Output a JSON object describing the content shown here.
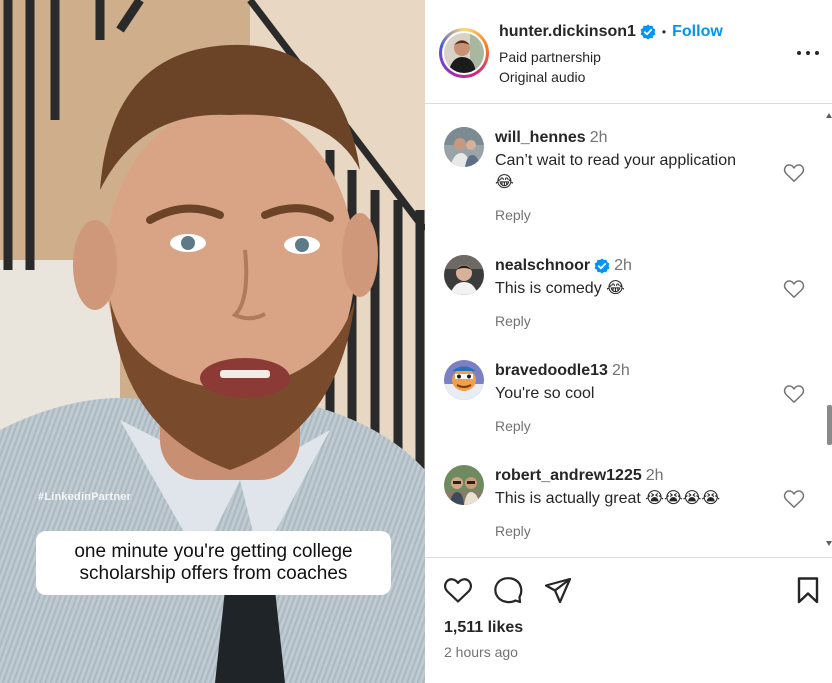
{
  "video": {
    "watermark": "#LinkedinPartner",
    "caption": "one minute you're getting college scholarship offers from coaches"
  },
  "post": {
    "username": "hunter.dickinson1",
    "verified": true,
    "separator": "•",
    "follow_label": "Follow",
    "subtitle_1": "Paid partnership",
    "subtitle_2": "Original audio",
    "more_icon": "more-horizontal-icon"
  },
  "comments": [
    {
      "user": "will_hennes",
      "verified": false,
      "time": "2h",
      "text": "Can’t wait to read your application",
      "emoji": "😂",
      "reply_label": "Reply"
    },
    {
      "user": "nealschnoor",
      "verified": true,
      "time": "2h",
      "text": "This is comedy 😂",
      "reply_label": "Reply"
    },
    {
      "user": "bravedoodle13",
      "verified": false,
      "time": "2h",
      "text": "You're so cool",
      "reply_label": "Reply"
    },
    {
      "user": "robert_andrew1225",
      "verified": false,
      "time": "2h",
      "text": "This is actually great 😭😭😭😭",
      "reply_label": "Reply"
    }
  ],
  "actions": {
    "like_icon": "heart-icon",
    "comment_icon": "comment-icon",
    "share_icon": "send-icon",
    "save_icon": "bookmark-icon",
    "likes": "1,511 likes",
    "time_ago": "2 hours ago"
  },
  "colors": {
    "accent": "#0095f6",
    "text": "#262626",
    "muted": "#737373",
    "divider": "#dbdbdb"
  }
}
